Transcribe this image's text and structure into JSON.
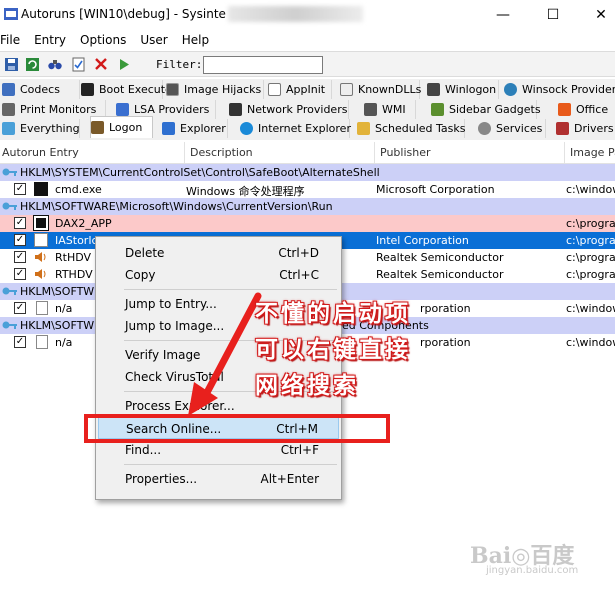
{
  "window": {
    "title": "Autoruns [WIN10\\debug] - Sysinte",
    "minimize": "—",
    "maximize": "☐",
    "close": "✕"
  },
  "menu": [
    "File",
    "Entry",
    "Options",
    "User",
    "Help"
  ],
  "toolbar": {
    "filter_label": "Filter:",
    "filter_value": ""
  },
  "tabs_row1": [
    "Codecs",
    "Boot Execute",
    "Image Hijacks",
    "AppInit",
    "KnownDLLs",
    "Winlogon",
    "Winsock Providers"
  ],
  "tabs_row2": [
    "Print Monitors",
    "LSA Providers",
    "Network Providers",
    "WMI",
    "Sidebar Gadgets",
    "Office"
  ],
  "tabs_row3": [
    "Everything",
    "Logon",
    "Explorer",
    "Internet Explorer",
    "Scheduled Tasks",
    "Services",
    "Drivers"
  ],
  "columns": [
    "Autorun Entry",
    "Description",
    "Publisher",
    "Image Pa"
  ],
  "rows": [
    {
      "entry": "HKLM\\SYSTEM\\CurrentControlSet\\Control\\SafeBoot\\AlternateShell",
      "desc": "",
      "pub": "",
      "img": ""
    },
    {
      "entry": "cmd.exe",
      "desc": "Windows 命令处理程序",
      "pub": "Microsoft Corporation",
      "img": "c:\\window"
    },
    {
      "entry": "HKLM\\SOFTWARE\\Microsoft\\Windows\\CurrentVersion\\Run",
      "desc": "",
      "pub": "",
      "img": ""
    },
    {
      "entry": "DAX2_APP",
      "desc": "",
      "pub": "",
      "img": "c:\\program"
    },
    {
      "entry": "IAStorIc",
      "desc": "",
      "pub": "Intel Corporation",
      "img": "c:\\program"
    },
    {
      "entry": "RtHDV",
      "desc": "",
      "pub": "Realtek Semiconductor",
      "img": "c:\\program"
    },
    {
      "entry": "RTHDV",
      "desc": "",
      "pub": "Realtek Semiconductor",
      "img": "c:\\program"
    },
    {
      "entry": "HKLM\\SOFTW",
      "desc": "",
      "pub": "",
      "img": ""
    },
    {
      "entry": "n/a",
      "desc": "",
      "pub": "rporation",
      "img": "c:\\window"
    },
    {
      "entry": "HKLM\\SOFTW",
      "desc": "ed Components",
      "pub": "",
      "img": ""
    },
    {
      "entry": "n/a",
      "desc": "",
      "pub": "rporation",
      "img": "c:\\window"
    }
  ],
  "context_menu": [
    {
      "label": "Delete",
      "shortcut": "Ctrl+D"
    },
    {
      "label": "Copy",
      "shortcut": "Ctrl+C"
    },
    {
      "label": "Jump to Entry...",
      "shortcut": ""
    },
    {
      "label": "Jump to Image...",
      "shortcut": ""
    },
    {
      "label": "Verify Image",
      "shortcut": ""
    },
    {
      "label": "Check VirusTotal",
      "shortcut": ""
    },
    {
      "label": "Process Explorer...",
      "shortcut": ""
    },
    {
      "label": "Search Online...",
      "shortcut": "Ctrl+M"
    },
    {
      "label": "Find...",
      "shortcut": "Ctrl+F"
    },
    {
      "label": "Properties...",
      "shortcut": "Alt+Enter"
    }
  ],
  "annotation": {
    "line1": "不懂的启动项",
    "line2": "可以右键直接",
    "line3": "网络搜索",
    "color": "#e8201d"
  },
  "watermark": {
    "main": "Bai◎百度",
    "sub": "jingyan.baidu.com"
  },
  "colors": {
    "key_row": "#ccd0f7",
    "warning_row": "#fcc9c9",
    "selected_row": "#0a6fd6"
  }
}
